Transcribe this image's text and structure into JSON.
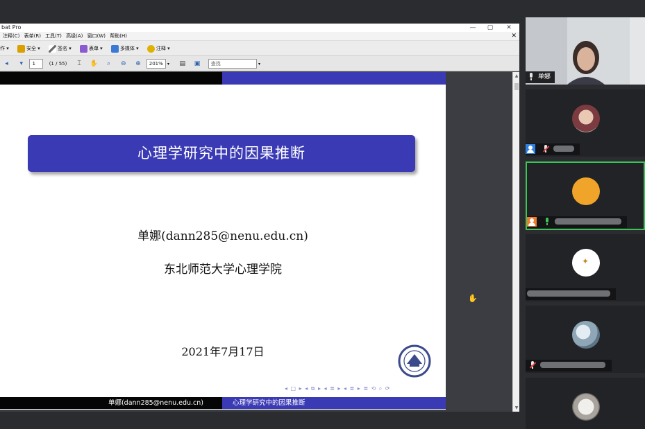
{
  "acrobat": {
    "title": "bat Pro",
    "window_controls": [
      "—",
      "▢",
      "✕"
    ],
    "menu": [
      "注释(C)",
      "表单(R)",
      "工具(T)",
      "高级(A)",
      "窗口(W)",
      "帮助(H)"
    ],
    "menu_close": "✕",
    "toolbar": [
      {
        "label": "作 ▾",
        "icon": "create-icon",
        "color": ""
      },
      {
        "label": "安全 ▾",
        "icon": "lock-icon",
        "color": "#d9a000"
      },
      {
        "label": "签名 ▾",
        "icon": "pen-icon",
        "color": "#6a6a6a"
      },
      {
        "label": "表单 ▾",
        "icon": "form-icon",
        "color": "#8a5bd0"
      },
      {
        "label": "多媒体 ▾",
        "icon": "multimedia-icon",
        "color": "#3b79d4"
      },
      {
        "label": "注释 ▾",
        "icon": "comment-icon",
        "color": "#e0b200"
      }
    ],
    "nav": {
      "page_input": "1",
      "page_count": "(1 / 55)",
      "zoom": "201%",
      "search_placeholder": "查找"
    }
  },
  "slide": {
    "title": "心理学研究中的因果推断",
    "author": "单娜(dann285@nenu.edu.cn)",
    "institution": "东北师范大学心理学院",
    "date": "2021年7月17日",
    "nav_symbols": "◂ □ ▸ ◂ ⧉ ▸ ◂ ≣ ▸ ◂ ≣ ▸ ≣ ⟲ ⌕ ⟳",
    "footer_left": "单娜(dann285@nenu.edu.cn)",
    "footer_right": "心理学研究中的因果推断",
    "colors": {
      "theme_blue": "#3b3ab5",
      "header_black": "#050505"
    }
  },
  "participants": [
    {
      "name": "单娜",
      "mic": "on",
      "type": "video"
    },
    {
      "name": "",
      "mic": "muted",
      "type": "avatar-photo"
    },
    {
      "name": "",
      "mic": "speaking",
      "type": "avatar-orange",
      "active": true
    },
    {
      "name": "",
      "mic": "none",
      "type": "avatar-bird"
    },
    {
      "name": "",
      "mic": "muted",
      "type": "avatar-flowers"
    },
    {
      "name": "",
      "mic": "none",
      "type": "avatar-dog"
    }
  ],
  "colors": {
    "active_speaker": "#3cc457",
    "muted": "#e84545",
    "panel_bg": "#2a2c2f"
  }
}
